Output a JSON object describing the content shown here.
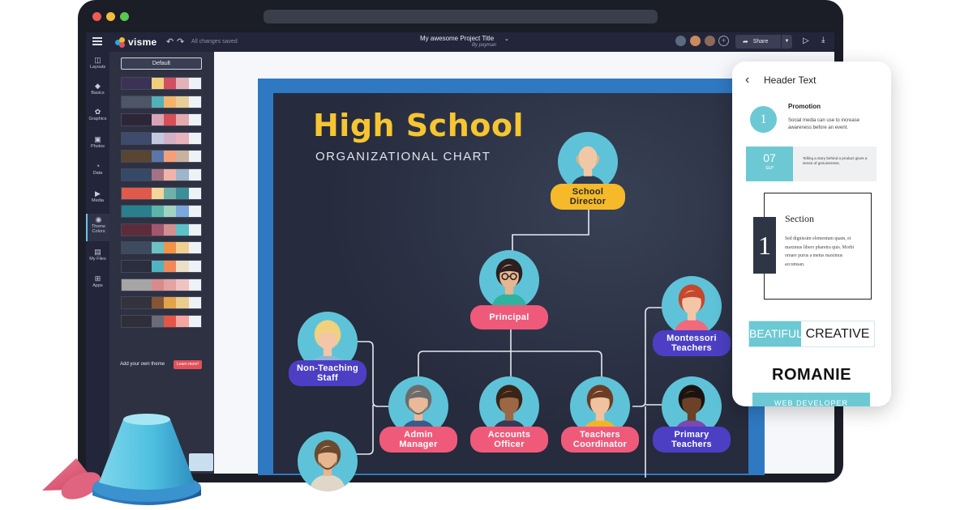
{
  "editor": {
    "logo_text": "visme",
    "autosave_status": "All changes saved",
    "project_title": "My awesome Project Title",
    "project_author": "By payman",
    "share_label": "Share"
  },
  "tools": [
    {
      "label": "Layouts"
    },
    {
      "label": "Basics"
    },
    {
      "label": "Graphics"
    },
    {
      "label": "Photos"
    },
    {
      "label": "Data"
    },
    {
      "label": "Media"
    },
    {
      "label": "Theme Colors"
    },
    {
      "label": "My Files"
    },
    {
      "label": "Apps"
    }
  ],
  "theme_panel": {
    "default_label": "Default",
    "add_own_label": "Add your own theme",
    "learn_more_label": "Learn more!",
    "palettes": [
      [
        "#3b3355",
        "#f0cf7a",
        "#d04f62",
        "#e1b3b8",
        "#eef1f5"
      ],
      [
        "#4e5566",
        "#52b1b7",
        "#f2b46a",
        "#e9cd99",
        "#eef1f5"
      ],
      [
        "#2d2636",
        "#d8a4b6",
        "#d74e56",
        "#e2a9b0",
        "#eef1f5"
      ],
      [
        "#3f4b6c",
        "#c3c8dd",
        "#d4b0c6",
        "#e7b3bc",
        "#eef1f5"
      ],
      [
        "#5a4432",
        "#5a76a8",
        "#f2a07a",
        "#c9b1a0",
        "#eef1f5"
      ],
      [
        "#364a67",
        "#a47281",
        "#f0b3a9",
        "#9fb5c9",
        "#eef1f5"
      ],
      [
        "#e05a4c",
        "#f2d69b",
        "#6fb1a9",
        "#3c8f99",
        "#eef1f5"
      ],
      [
        "#2a7f8c",
        "#5db5a9",
        "#a0d3c2",
        "#7aa8dc",
        "#eef1f5"
      ],
      [
        "#5d2c3b",
        "#a4566e",
        "#d28f8f",
        "#5cc0c8",
        "#eef1f5"
      ],
      [
        "#3e4b5f",
        "#6cc1c3",
        "#f19346",
        "#f1cf93",
        "#eef1f5"
      ],
      [
        "#2b2f3d",
        "#4fb3c0",
        "#f0895a",
        "#e9e0c7",
        "#eef1f5"
      ],
      [
        "#a5a5a5",
        "#d98b8b",
        "#e2a3a3",
        "#f0c3c3",
        "#eef1f5"
      ],
      [
        "#33323d",
        "#845634",
        "#e3a24c",
        "#e9cd8e",
        "#eef1f5"
      ],
      [
        "#2e2f38",
        "#6a6c78",
        "#e45545",
        "#f4a6a0",
        "#eef1f5"
      ]
    ]
  },
  "slide": {
    "title": "High School",
    "subtitle": "ORGANIZATIONAL CHART",
    "nodes": {
      "director": "School\nDirector",
      "principal": "Principal",
      "non_teaching": "Non-Teaching\nStaff",
      "montessori": "Montessori\nTeachers",
      "admin": "Admin\nManager",
      "accounts": "Accounts\nOfficer",
      "teachers_coord": "Teachers\nCoordinator",
      "primary": "Primary\nTeachers"
    }
  },
  "phone": {
    "header": "Header Text",
    "promo_number": "1",
    "promo_title": "Promotion",
    "promo_text": "Social media can use to increase awareness before an event.",
    "date_day": "07",
    "date_month": "SEP",
    "date_text": "Telling a story behind a product gives a sense of genuineness.",
    "section_number": "1",
    "section_title": "Section",
    "section_text": "Sed dignissim elementum quam, et maximus libero pharetra quis. Morbi ornare purus a metus maximus accumsan.",
    "beat_left": "BEATIFUL",
    "beat_right": "CREATIVE",
    "romanie": "ROMANIE",
    "webdev": "WEB DEVELOPER"
  },
  "colors": {
    "accent_teal": "#6cc9d4",
    "slide_bg": "#262b3d",
    "title_yellow": "#f6c532",
    "pill_pink": "#ef5a7a",
    "pill_blue": "#4c3fc4",
    "pill_yellow": "#f5b92a"
  }
}
